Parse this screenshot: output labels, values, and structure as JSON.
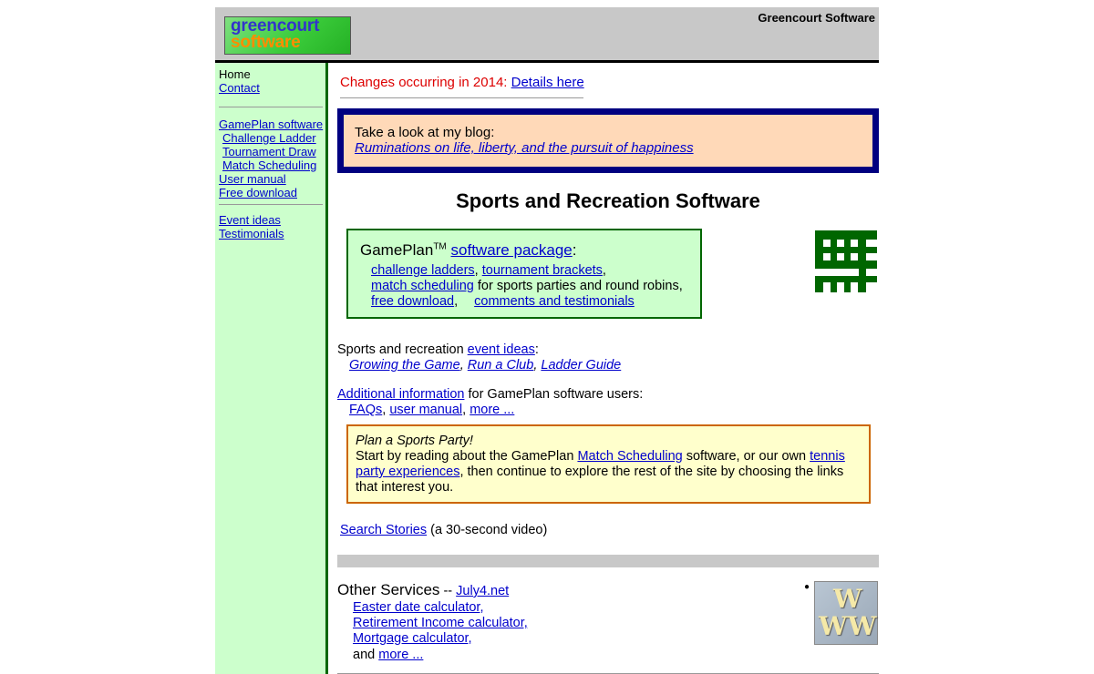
{
  "header": {
    "logo_line1": "greencourt",
    "logo_line2": "software",
    "company": "Greencourt Software"
  },
  "sidebar": {
    "home": "Home",
    "contact": "Contact",
    "gameplan": "GamePlan software",
    "challenge_ladder": "Challenge Ladder",
    "tournament_draw": "Tournament Draw",
    "match_scheduling": "Match Scheduling",
    "user_manual": "User manual",
    "free_download": "Free download",
    "event_ideas": "Event ideas",
    "testimonials": "Testimonials"
  },
  "changes": {
    "text": "Changes occurring in 2014: ",
    "link": "Details here"
  },
  "blog": {
    "text": "Take a look at my blog:",
    "link": "Ruminations on life, liberty, and the pursuit of happiness"
  },
  "heading": "Sports and Recreation Software",
  "gameplan_box": {
    "title": "GamePlan",
    "tm": "TM",
    "package_link": "software package",
    "colon": ":",
    "challenge_ladders": "challenge ladders",
    "comma1": ", ",
    "tournament_brackets": "tournament brackets",
    "comma2": ",",
    "match_scheduling": "match scheduling",
    "match_suffix": " for sports parties and round robins,",
    "free_download": "free download",
    "comma3": ",",
    "comments": "comments and testimonials"
  },
  "events": {
    "prefix": "Sports and recreation ",
    "link": "event ideas",
    "colon": ":",
    "growing": "Growing the Game",
    "run_club": "Run a Club",
    "ladder_guide": "Ladder Guide",
    "sep": ", "
  },
  "additional": {
    "link": "Additional information",
    "suffix": " for GamePlan software users:",
    "faqs": "FAQs",
    "user_manual": "user manual",
    "more": "more ...",
    "sep": ", "
  },
  "party": {
    "title": "Plan a Sports Party!",
    "text1": "Start by reading about the GamePlan ",
    "link1": "Match Scheduling",
    "text2": " software, or our own ",
    "link2": "tennis party experiences",
    "text3": ", then continue to explore the rest of the site by choosing the links that interest you."
  },
  "video": {
    "link": "Search Stories",
    "suffix": " (a 30-second video)"
  },
  "other": {
    "title": "Other Services",
    "dash": " -- ",
    "link": "July4.net",
    "easter": "Easter date calculator,",
    "retirement": "Retirement Income calculator,",
    "mortgage": "Mortgage calculator,",
    "and": "and ",
    "more": "more ..."
  },
  "www_image": {
    "w1": "W",
    "w2": "W",
    "w3": "W"
  },
  "colors": {
    "header_bg": "#c8c8c8",
    "sidebar_bg": "#ccffcc",
    "sidebar_rule": "#006600",
    "blog_border": "#000080",
    "blog_bg": "#ffd9b8",
    "gameplan_bg": "#ccffcc",
    "party_bg": "#ffffcc",
    "party_border": "#cc6600",
    "changes_red": "#dd0000",
    "calendar_green": "#006600"
  },
  "icons": {
    "logo": "greencourt-logo",
    "calendar": "calendar-grid-icon",
    "www": "www-image"
  }
}
